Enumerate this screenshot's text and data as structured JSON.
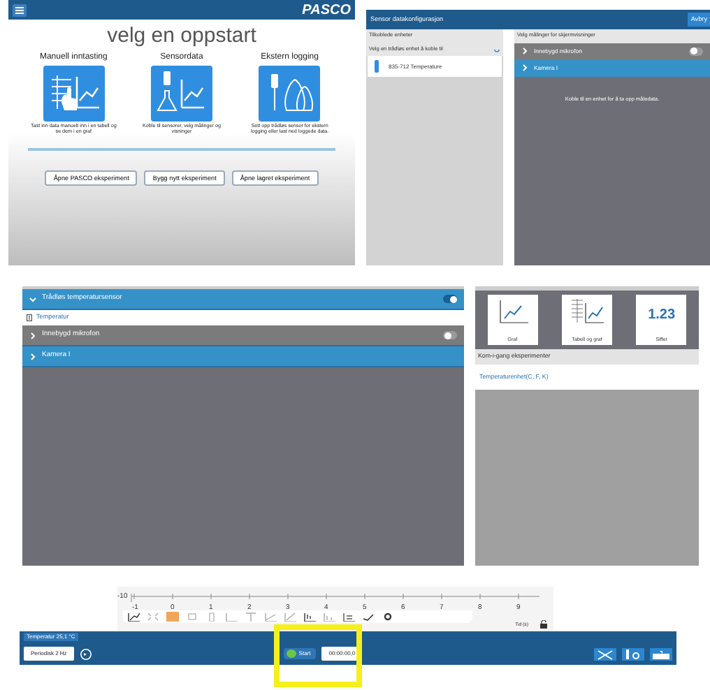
{
  "start_screen": {
    "logo": "PASCO",
    "heading": "velg en oppstart",
    "options": [
      {
        "kind": "manual",
        "label": "Manuell inntasting",
        "description": "Tast inn data manuelt inn i en tabell og se dem i en graf"
      },
      {
        "kind": "sensor",
        "label": "Sensordata",
        "description": "Koble til sensorer, velg målinger og visninger"
      },
      {
        "kind": "remote",
        "label": "Ekstern logging",
        "description": "Sett opp trådløs sensor for ekstern logging eller last ned loggede data."
      }
    ],
    "buttons": [
      "Åpne PASCO eksperiment",
      "Bygg nytt eksperiment",
      "Åpne lagret eksperiment"
    ]
  },
  "sensor_config": {
    "title": "Sensor datakonfigurasjon",
    "cancel": "Avbry",
    "devices_header": "Tilkoblede enheter",
    "device_prompt": "Velg en trådløs enhet å koble til",
    "devices": [
      "835-712 Temperature"
    ],
    "measurements_header": "Velg målinger for skjermvisninger",
    "groups": [
      {
        "kind": "builtin",
        "label": "Innebygd mikrofon",
        "expanded": false,
        "on": false
      },
      {
        "kind": "camera",
        "label": "Kamera I",
        "expanded": false
      }
    ],
    "message": "Koble til en enhet for å ta opp måledata."
  },
  "measurement_list": {
    "groups": [
      {
        "kind": "sensor",
        "label": "Trådløs temperatursensor",
        "expanded": true,
        "on": true,
        "children": [
          {
            "label": "Temperatur"
          }
        ]
      },
      {
        "kind": "builtin",
        "label": "Innebygd mikrofon",
        "expanded": false,
        "on": false
      },
      {
        "kind": "camera",
        "label": "Kamera I",
        "expanded": false
      }
    ]
  },
  "displays": {
    "tiles": [
      {
        "kind": "graph",
        "label": "Graf"
      },
      {
        "kind": "table-graph",
        "label": "Tabell og graf"
      },
      {
        "kind": "digits",
        "label": "Siffer",
        "value": "1.23"
      }
    ],
    "section": "Kom-i-gang eksperimenter",
    "experiments": [
      "Temperaturenhet(C, F, K)"
    ]
  },
  "controls": {
    "y_tick": "-10",
    "x_ticks": [
      "-1",
      "0",
      "1",
      "2",
      "3",
      "4",
      "5",
      "6",
      "7",
      "8",
      "9"
    ],
    "x_label": "Tid (s)",
    "live": "Temperatur 25,1 °C",
    "sampling": "Periodisk 2 Hz",
    "start": "Start",
    "timer": "00:00:00,0"
  }
}
